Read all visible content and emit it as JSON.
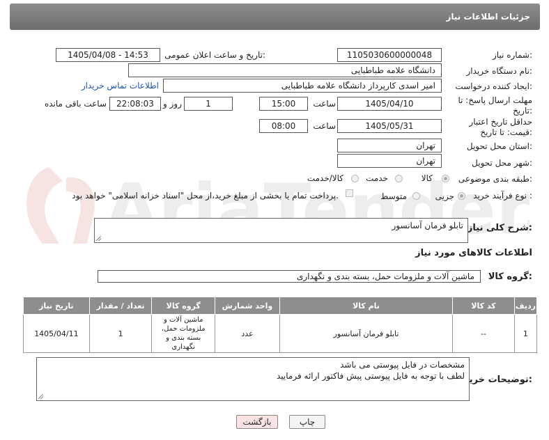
{
  "header": {
    "title": "جزئیات اطلاعات نیاز"
  },
  "form": {
    "need_number_label": "شماره نیاز:",
    "need_number": "1105030600000048",
    "announce_label": "تاریخ و ساعت اعلان عمومی:",
    "announce_value": "1405/04/08 - 14:53",
    "buyer_org_label": "نام دستگاه خریدار:",
    "buyer_org": "دانشگاه علامه طباطبایی",
    "creator_label": "ایجاد کننده درخواست:",
    "creator": "امیر اسدی کارپرداز دانشگاه علامه طباطبایی",
    "contact_link": "اطلاعات تماس خریدار",
    "deadline_label": "مهلت ارسال پاسخ: تا تاریخ:",
    "deadline_date": "1405/04/10",
    "time_label": "ساعت",
    "deadline_time": "15:00",
    "days_value": "1",
    "days_label": "روز و",
    "remaining_time": "22:08:03",
    "remaining_label": "ساعت باقی مانده",
    "validity_label": "حداقل تاریخ اعتبار قیمت: تا تاریخ:",
    "validity_date": "1405/05/31",
    "validity_time_label": "ساعت",
    "validity_time": "08:00",
    "province_label": "استان محل تحویل:",
    "province": "تهران",
    "city_label": "شهر محل تحویل:",
    "city": "تهران",
    "category_label": "طبقه بندی موضوعی:",
    "category_options": [
      "کالا",
      "خدمت",
      "کالا/خدمت"
    ],
    "process_label": "نوع فرآیند خرید :",
    "process_options": [
      "جزیی",
      "متوسط"
    ],
    "treasury_note": "پرداخت تمام یا بخشی از مبلغ خرید،از محل \"اسناد خزانه اسلامی\" خواهد بود."
  },
  "description": {
    "label": "شرح کلی نیاز:",
    "value": "تابلو فرمان آسانسور"
  },
  "items_section": {
    "title": "اطلاعات کالاهای مورد نیاز",
    "group_label": "گروه کالا:",
    "group_value": "ماشین آلات و ملزومات حمل، بسته بندی و نگهداری"
  },
  "table": {
    "headers": [
      "ردیف",
      "کد کالا",
      "نام کالا",
      "واحد شمارش",
      "گروه کالا",
      "تعداد / مقدار",
      "تاریخ نیاز"
    ],
    "row": {
      "index": "1",
      "code": "--",
      "name": "تابلو فرمان آسانسور",
      "unit": "عدد",
      "group": "ماشین آلات و ملزومات حمل، بسته بندی و نگهداری",
      "qty": "1",
      "date": "1405/04/11"
    }
  },
  "buyer_notes": {
    "label": "توضیحات خریدار:",
    "line1": "مشخصات در فایل پیوستی می باشد",
    "line2": "لطف با توجه به فایل پیوستی پیش فاکتور ارائه فرمایید"
  },
  "buttons": {
    "print": "چاپ",
    "back": "بازگشت"
  },
  "watermark": {
    "text": "AriaTender.neT"
  },
  "colors": {
    "header_bg": "#7d7d7d",
    "link": "#1a55b5",
    "back_bg": "#fbe3e3"
  }
}
